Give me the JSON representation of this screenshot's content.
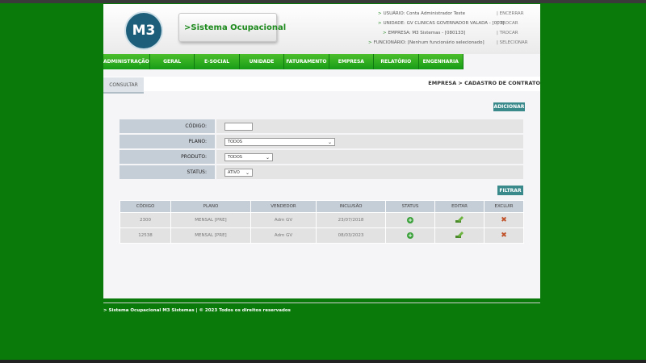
{
  "header": {
    "logo_text": "M3",
    "system_name": ">Sistema Ocupacional",
    "info": [
      {
        "label": "USUÁRIO:",
        "value": "Conta Administrador Teste",
        "action": "ENCERRAR"
      },
      {
        "label": "UNIDADE:",
        "value": "GV CLINICAS GOVERNADOR VALADA - [003]",
        "action": "TROCAR"
      },
      {
        "label": "EMPRESA:",
        "value": "M3 Sistemas - [080133]",
        "action": "TROCAR"
      },
      {
        "label": "FUNCIONÁRIO:",
        "value": "[Nenhum funcionário selecionado]",
        "action": "SELECIONAR"
      }
    ]
  },
  "menu": [
    "ADMINISTRAÇÃO",
    "GERAL",
    "E-SOCIAL",
    "UNIDADE",
    "FATURAMENTO",
    "EMPRESA",
    "RELATÓRIO",
    "ENGENHARIA"
  ],
  "tab_label": "CONSULTAR",
  "breadcrumb": "EMPRESA > CADASTRO DE CONTRATO",
  "buttons": {
    "add": "ADICIONAR",
    "filter": "FILTRAR"
  },
  "form": {
    "codigo_label": "CÓDIGO:",
    "codigo_value": "",
    "plano_label": "PLANO:",
    "plano_value": "TODOS",
    "produto_label": "PRODUTO:",
    "produto_value": "TODOS",
    "status_label": "STATUS:",
    "status_value": "ATIVO"
  },
  "table": {
    "headers": [
      "CÓDIGO",
      "PLANO",
      "VENDEDOR",
      "INCLUSÃO",
      "STATUS",
      "EDITAR",
      "EXCLUIR"
    ],
    "rows": [
      {
        "codigo": "2300",
        "plano": "MENSAL [PRE]",
        "vendedor": "Adm GV",
        "inclusao": "23/07/2018"
      },
      {
        "codigo": "12538",
        "plano": "MENSAL [PRE]",
        "vendedor": "Adm GV",
        "inclusao": "08/03/2023"
      }
    ]
  },
  "footer": "> Sistema Ocupacional M3 Sistemas | © 2023 Todos os direitos reservados"
}
